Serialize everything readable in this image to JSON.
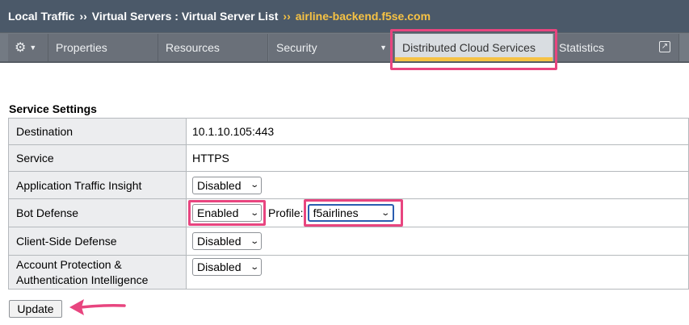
{
  "breadcrumb": {
    "root": "Local Traffic",
    "separator": "››",
    "section": "Virtual Servers : Virtual Server List",
    "current": "airline-backend.f5se.com"
  },
  "tabs": {
    "properties": "Properties",
    "resources": "Resources",
    "security": "Security",
    "distributed_cloud": "Distributed Cloud Services",
    "statistics": "Statistics"
  },
  "service_settings": {
    "title": "Service Settings",
    "destination_label": "Destination",
    "destination_value": "10.1.10.105:443",
    "service_label": "Service",
    "service_value": "HTTPS",
    "ati_label": "Application Traffic Insight",
    "ati_value": "Disabled",
    "bot_label": "Bot Defense",
    "bot_value": "Enabled",
    "profile_label": "Profile:",
    "profile_value": "f5airlines",
    "csd_label": "Client-Side Defense",
    "csd_value": "Disabled",
    "apai_label_line1": "Account Protection &",
    "apai_label_line2": "Authentication Intelligence",
    "apai_value": "Disabled"
  },
  "update_button": "Update",
  "icons": {
    "gear": "gear-icon",
    "external": "external-link-icon",
    "dropdown": "chevron-down-icon"
  },
  "colors": {
    "header_bg": "#4b5969",
    "breadcrumb_current": "#f6c244",
    "active_tab_underline": "#f6c244",
    "highlight": "#e8457f"
  }
}
